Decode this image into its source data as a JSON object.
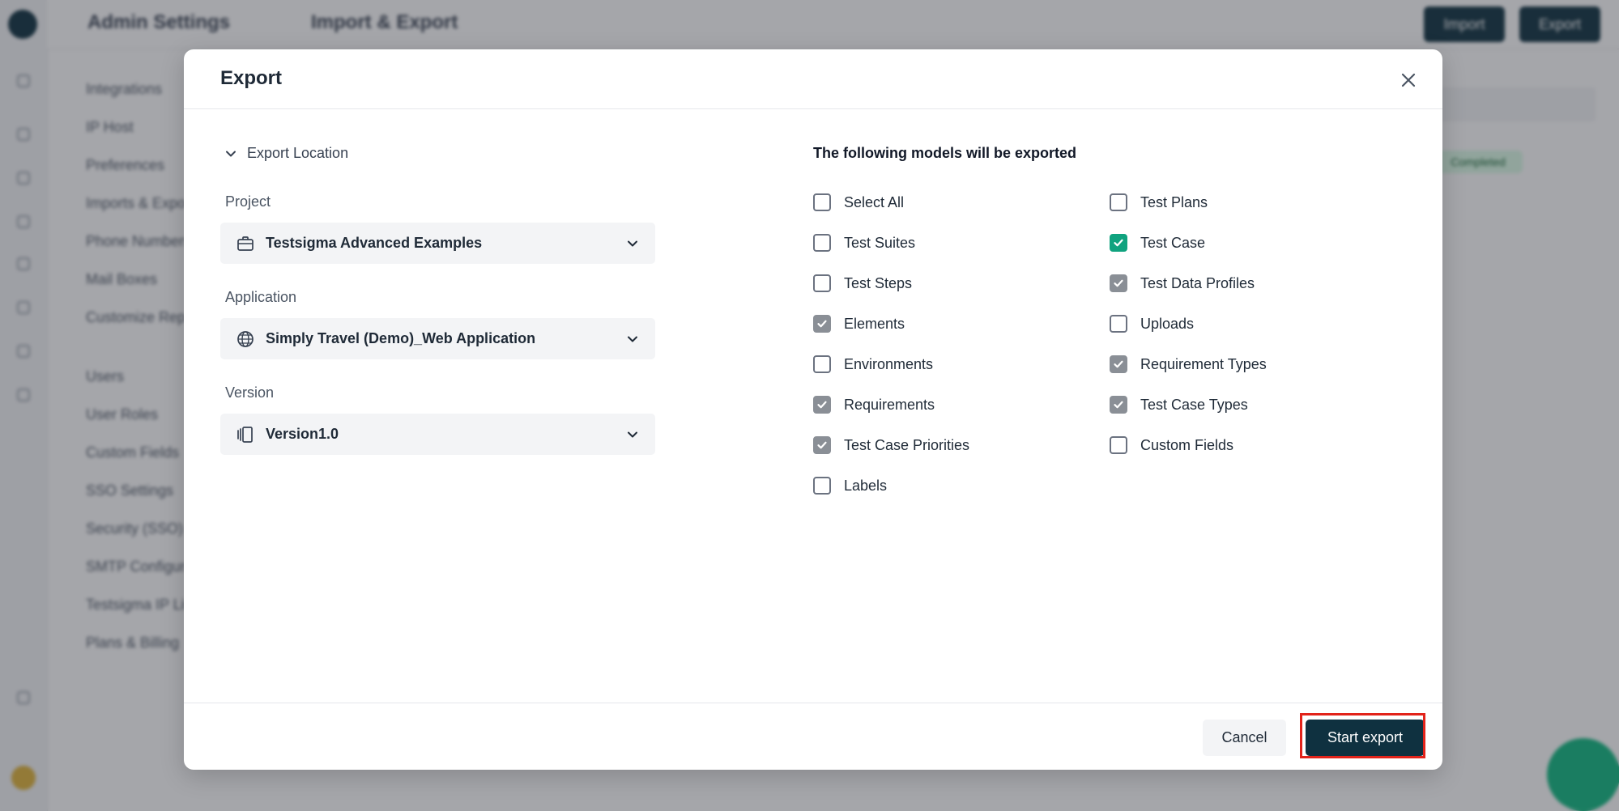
{
  "background": {
    "header": {
      "crumb_1": "Admin Settings",
      "crumb_2": "Import & Export",
      "import_label": "Import",
      "export_label": "Export"
    },
    "settings_nav": {
      "items": [
        "Integrations",
        "IP Host",
        "Preferences",
        "Imports & Exports",
        "Phone Numbers",
        "Mail Boxes",
        "Customize Reports"
      ],
      "items_2": [
        "Users",
        "User Roles",
        "Custom Fields",
        "SSO Settings",
        "Security (SSO)",
        "SMTP Configuration",
        "Testsigma IP Lists",
        "Plans & Billing"
      ]
    },
    "status_badge": "Completed"
  },
  "modal": {
    "title": "Export",
    "export_location": {
      "toggle_label": "Export Location",
      "project": {
        "label": "Project",
        "value": "Testsigma Advanced Examples",
        "icon": "briefcase-icon"
      },
      "application": {
        "label": "Application",
        "value": "Simply Travel (Demo)_Web Application",
        "icon": "globe-icon"
      },
      "version": {
        "label": "Version",
        "value": "Version1.0",
        "icon": "versions-icon"
      }
    },
    "models": {
      "heading": "The following models will be exported",
      "left": [
        {
          "label": "Select All",
          "checked": false
        },
        {
          "label": "Test Suites",
          "checked": false
        },
        {
          "label": "Test Steps",
          "checked": false
        },
        {
          "label": "Elements",
          "checked": true
        },
        {
          "label": "Environments",
          "checked": false
        },
        {
          "label": "Requirements",
          "checked": true
        },
        {
          "label": "Test Case Priorities",
          "checked": true
        },
        {
          "label": "Labels",
          "checked": false
        }
      ],
      "right": [
        {
          "label": "Test Plans",
          "checked": false
        },
        {
          "label": "Test Case",
          "checked": true,
          "accent": "#10a37f"
        },
        {
          "label": "Test Data Profiles",
          "checked": true
        },
        {
          "label": "Uploads",
          "checked": false
        },
        {
          "label": "Requirement Types",
          "checked": true
        },
        {
          "label": "Test Case Types",
          "checked": true
        },
        {
          "label": "Custom Fields",
          "checked": false
        }
      ]
    },
    "footer": {
      "cancel_label": "Cancel",
      "start_label": "Start export"
    }
  },
  "colors": {
    "primary": "#0f3140",
    "checked_accent": "#10a37f",
    "checked_gray": "#8a8f96",
    "highlight": "#e2231a"
  }
}
